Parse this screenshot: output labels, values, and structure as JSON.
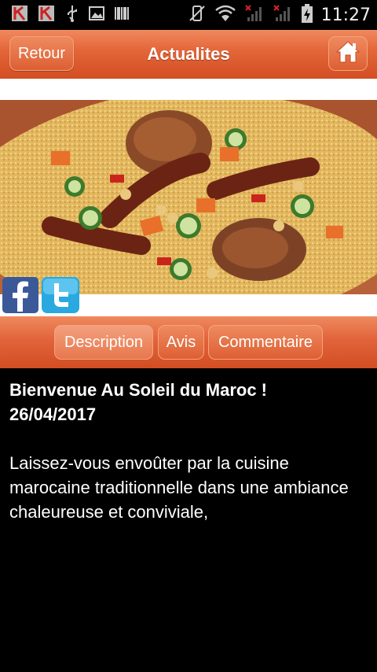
{
  "status_bar": {
    "time": "11:27",
    "left_icons": [
      "k-notification-icon",
      "k-notification-icon",
      "usb-icon",
      "image-icon",
      "barcode-icon"
    ],
    "right_icons": [
      "vibrate-off-icon",
      "wifi-icon",
      "signal-no-service-icon",
      "signal-no-service-icon",
      "battery-charging-icon"
    ]
  },
  "header": {
    "back_label": "Retour",
    "title": "Actualites",
    "home_icon": "home-icon"
  },
  "social": {
    "facebook_icon": "facebook-icon",
    "twitter_icon": "twitter-icon"
  },
  "tabs": [
    {
      "label": "Description",
      "active": true
    },
    {
      "label": "Avis",
      "active": false
    },
    {
      "label": "Commentaire",
      "active": false
    }
  ],
  "article": {
    "heading_line1": "Bienvenue Au Soleil du Maroc !",
    "heading_line2": "26/04/2017",
    "body": "Laissez-vous envoûter par la cuisine marocaine traditionnelle dans une ambiance chaleureuse et conviviale,"
  },
  "colors": {
    "accent": "#e4673a",
    "accent_dark": "#d24e22",
    "background": "#000000",
    "text": "#ffffff"
  }
}
